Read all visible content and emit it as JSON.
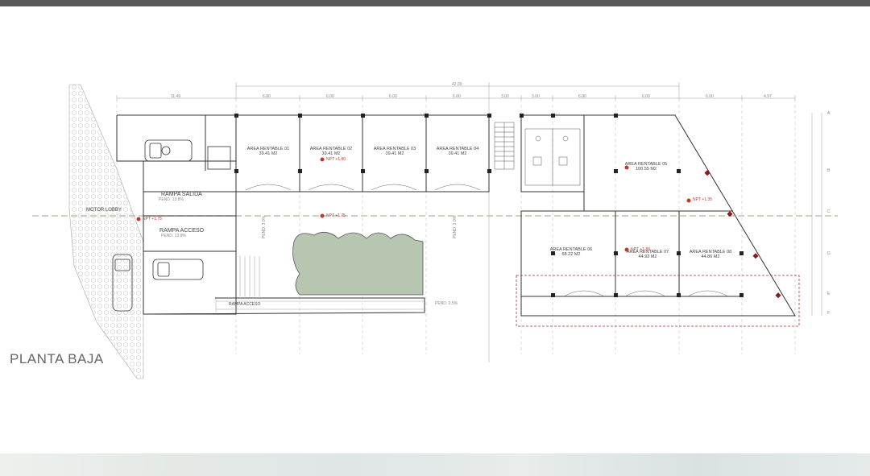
{
  "plan": {
    "title": "PLANTA BAJA",
    "overall_dimension": "42.00",
    "dimensions": [
      "11.49",
      "6.00",
      "6.00",
      "6.00",
      "6.00",
      "3.00",
      "3.00",
      "6.00",
      "6.00",
      "6.00",
      "4.97"
    ],
    "units": [
      {
        "name": "AREA RENTABLE 01",
        "area": "39.41 M2"
      },
      {
        "name": "AREA RENTABLE 02",
        "area": "39.41 M2"
      },
      {
        "name": "AREA RENTABLE 03",
        "area": "39.41 M2"
      },
      {
        "name": "AREA RENTABLE 04",
        "area": "39.41 M2"
      },
      {
        "name": "AREA RENTABLE 05",
        "area": "100.55 M2"
      },
      {
        "name": "AREA RENTABLE 06",
        "area": "68.22 M2"
      },
      {
        "name": "AREA RENTABLE 07",
        "area": "44.92 M2"
      },
      {
        "name": "AREA RENTABLE 08",
        "area": "44.86 M2"
      }
    ],
    "ramps": {
      "salida": {
        "label": "RAMPA SALIDA",
        "slope": "PEND. 13.8%"
      },
      "acceso": {
        "label": "RAMPA ACCESO",
        "slope": "PEND. 13.8%"
      },
      "acceso_bottom": "RAMPA ACCESO"
    },
    "motorlobby": "MOTOR LOBBY",
    "levels": [
      "NPT +1.80",
      "NPT +1.75",
      "NPT +1.35",
      "NPT +1.80",
      "NPT +1.75"
    ],
    "slopes": [
      "PEND. 3.0%",
      "PEND. 3.0%",
      "PEND. 0.5%"
    ],
    "grid_rows": [
      "A",
      "B",
      "C",
      "D",
      "E",
      "F"
    ]
  },
  "colors": {
    "topbar": "#5a5957",
    "garden": "#b7c6b1",
    "walls": "#333333",
    "red_line": "#c0392b"
  }
}
